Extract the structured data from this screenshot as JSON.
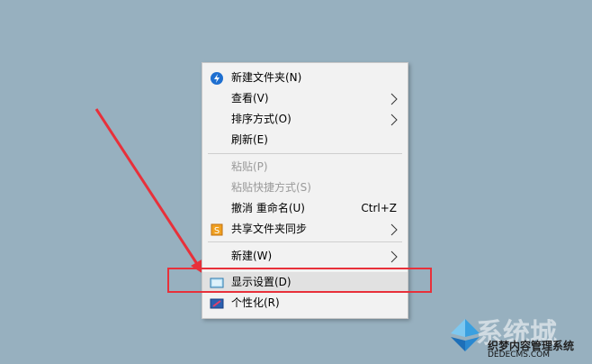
{
  "context_menu": {
    "items": [
      {
        "label": "新建文件夹(N)",
        "icon": "new-folder-icon"
      },
      {
        "label": "查看(V)",
        "submenu": true
      },
      {
        "label": "排序方式(O)",
        "submenu": true
      },
      {
        "label": "刷新(E)"
      },
      {
        "label": "粘贴(P)",
        "disabled": true
      },
      {
        "label": "粘贴快捷方式(S)",
        "disabled": true
      },
      {
        "label": "撤消 重命名(U)",
        "shortcut": "Ctrl+Z"
      },
      {
        "label": "共享文件夹同步",
        "icon": "sync-app-icon",
        "submenu": true
      },
      {
        "label": "新建(W)",
        "submenu": true
      },
      {
        "label": "显示设置(D)",
        "icon": "display-icon",
        "highlighted": true
      },
      {
        "label": "个性化(R)",
        "icon": "personalize-icon"
      }
    ]
  },
  "annotation": {
    "color": "#e8303a"
  },
  "watermark": {
    "title": "系统城",
    "line1": "织梦内容管理系统",
    "line2": "DEDECMS.COM"
  }
}
